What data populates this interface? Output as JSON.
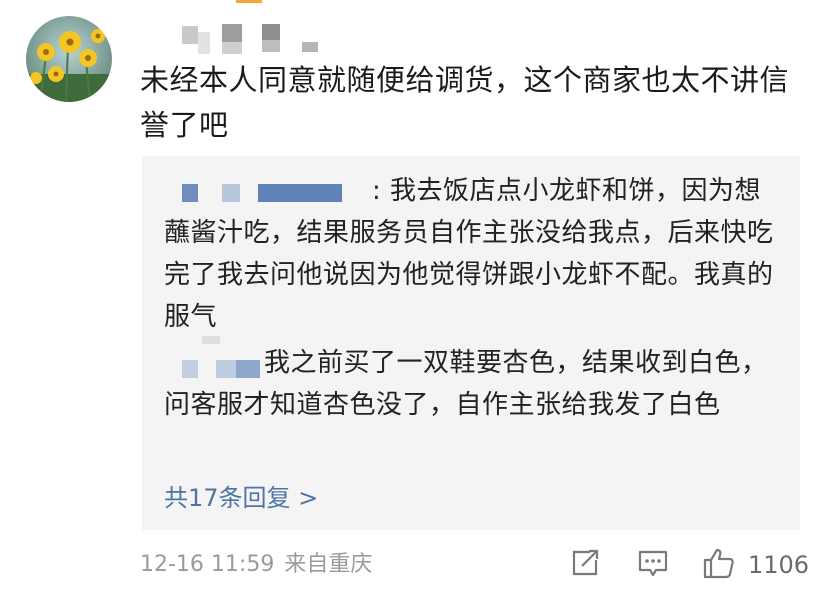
{
  "comment": {
    "text": "未经本人同意就随便给调货，这个商家也太不讲信誉了吧"
  },
  "replies": [
    {
      "text": ": 我去饭店点小龙虾和饼，因为想蘸酱汁吃，结果服务员自作主张没给我点，后来快吃完了我去问他说因为他觉得饼跟小龙虾不配。我真的服气"
    },
    {
      "text": "我之前买了一双鞋要杏色，结果收到白色，问客服才知道杏色没了，自作主张给我发了白色"
    }
  ],
  "more_replies_label": "共17条回复 >",
  "meta": {
    "time": "12-16 11:59",
    "source": "来自重庆"
  },
  "actions": {
    "likes": "1106",
    "share_icon": "share-icon",
    "comment_icon": "comment-icon",
    "like_icon": "thumbs-up-icon"
  },
  "colors": {
    "link": "#4e74a6",
    "meta": "#9b9b9b",
    "reply_bg": "#f4f4f4",
    "accent": "#f7a53a"
  }
}
